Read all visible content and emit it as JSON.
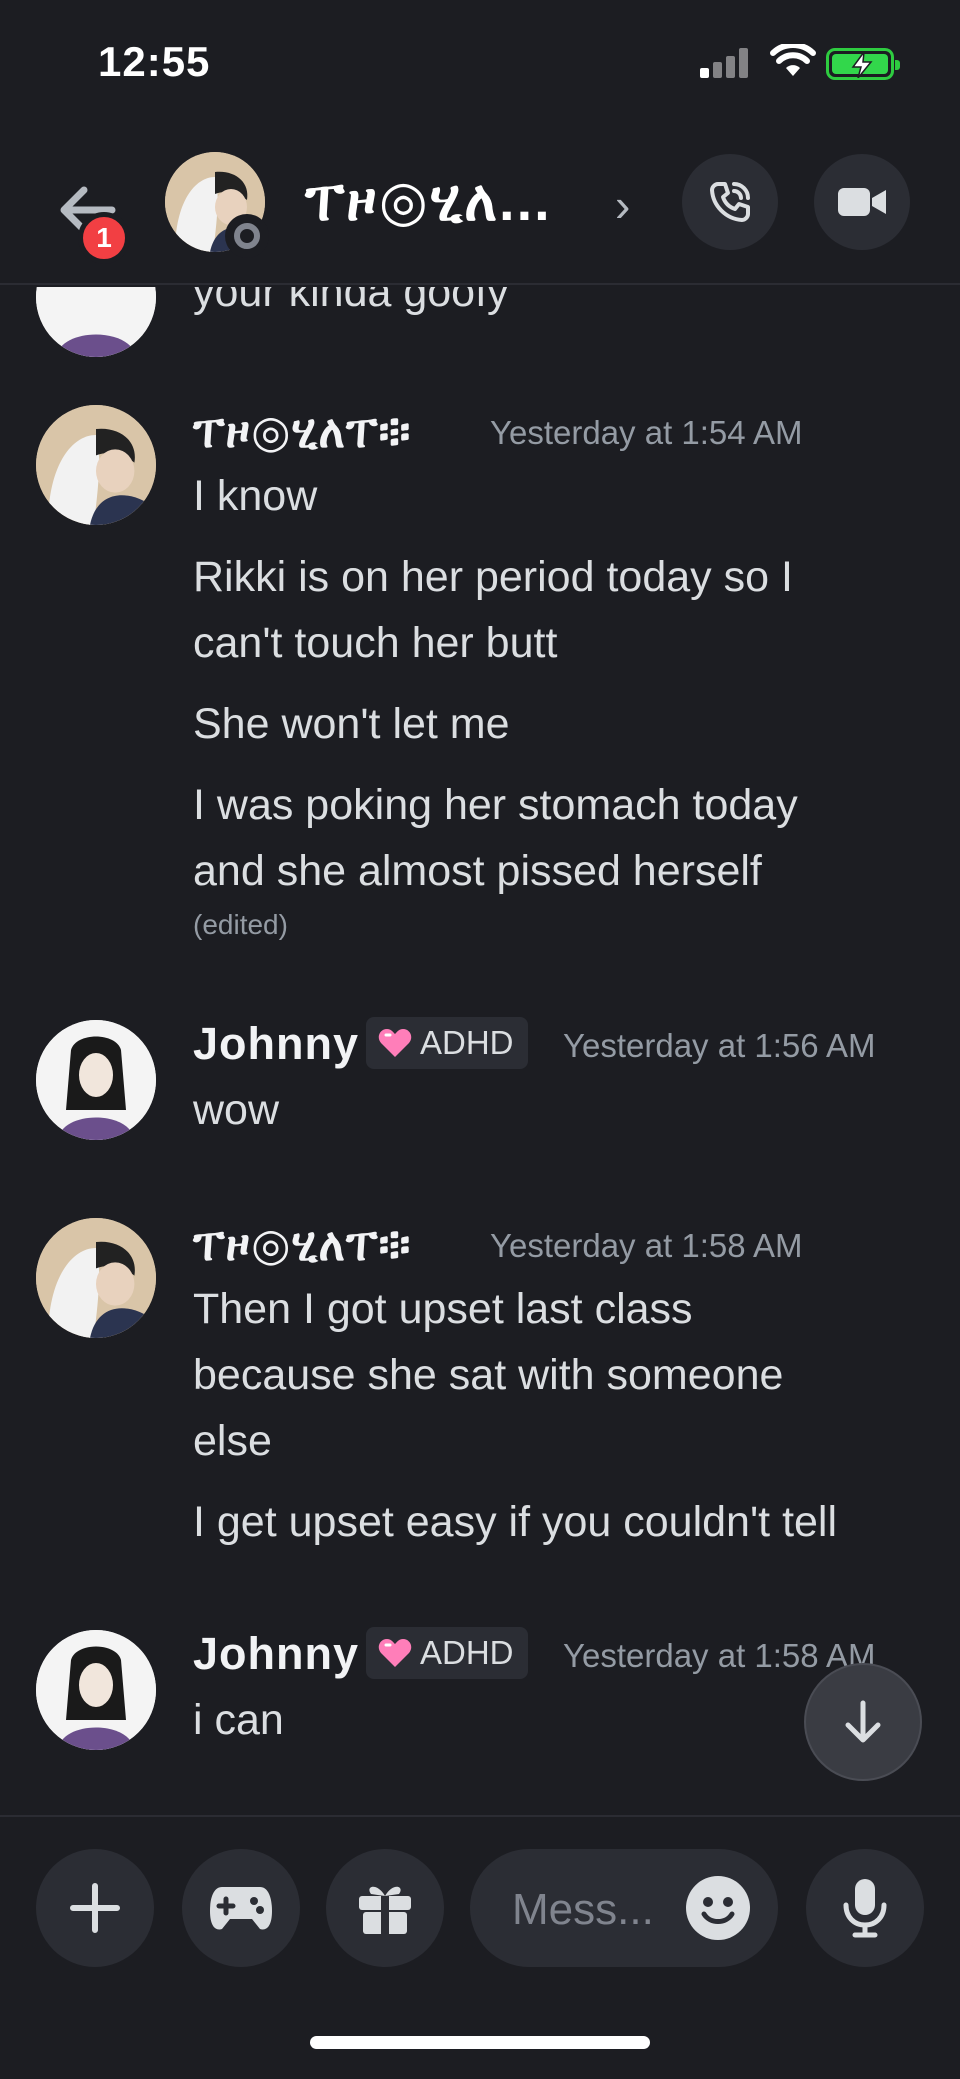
{
  "status_bar": {
    "time": "12:55"
  },
  "header": {
    "title": "ፐዞ◎ሂለ...",
    "notification_count": "1"
  },
  "messages": {
    "partial_text": "your kinda goofy",
    "group1": {
      "username": "ፐዞ◎ሂለፐ፨",
      "timestamp": "Yesterday at 1:54 AM",
      "lines": [
        "I know",
        "Rikki is on her period today so I",
        "can't touch her butt",
        "She won't let me",
        "I was poking her stomach today",
        "and she almost pissed herself"
      ],
      "edited": "(edited)"
    },
    "group2": {
      "username": "Johnny",
      "role": "ADHD",
      "timestamp": "Yesterday at 1:56 AM",
      "lines": [
        "wow"
      ]
    },
    "group3": {
      "username": "ፐዞ◎ሂለፐ፨",
      "timestamp": "Yesterday at 1:58 AM",
      "lines": [
        "Then I got upset last class",
        "because she sat with someone",
        "else",
        "I get upset easy if you couldn't tell"
      ]
    },
    "group4": {
      "username": "Johnny",
      "role": "ADHD",
      "timestamp": "Yesterday at 1:58 AM",
      "lines": [
        "i can"
      ]
    }
  },
  "composer": {
    "placeholder": "Mess..."
  },
  "icons": {
    "back": "arrow-left-icon",
    "call": "phone-icon",
    "video": "video-camera-icon",
    "add": "plus-icon",
    "games": "gamepad-icon",
    "gift": "gift-icon",
    "emoji": "smile-icon",
    "mic": "microphone-icon",
    "scroll": "arrow-down-icon",
    "role": "heart-icon"
  },
  "colors": {
    "background": "#1c1d22",
    "badge": "#f23f43",
    "battery": "#32d74b",
    "role_heart": "#ff7eb9"
  }
}
